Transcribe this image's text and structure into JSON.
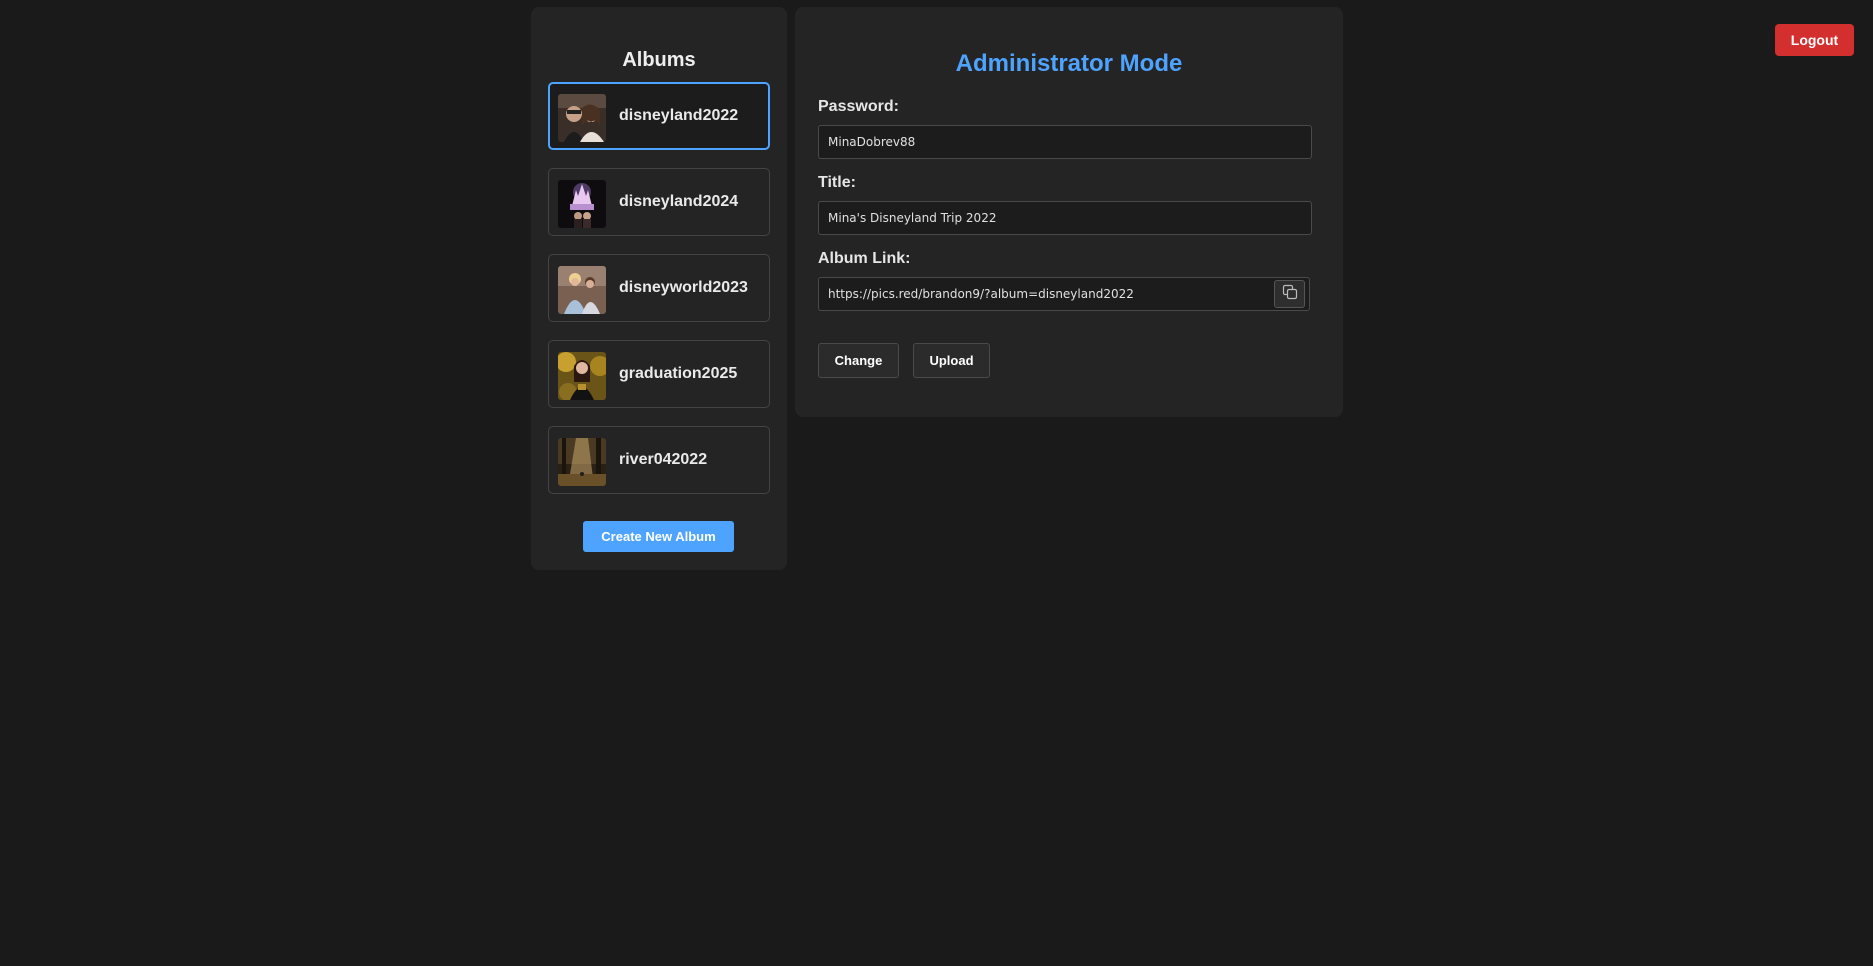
{
  "header": {
    "logout_label": "Logout",
    "logout_color": "#d32f2f"
  },
  "albums": {
    "title": "Albums",
    "items": [
      {
        "name": "disneyland2022",
        "selected": true
      },
      {
        "name": "disneyland2024",
        "selected": false
      },
      {
        "name": "disneyworld2023",
        "selected": false
      },
      {
        "name": "graduation2025",
        "selected": false
      },
      {
        "name": "river042022",
        "selected": false
      }
    ],
    "create_label": "Create New Album"
  },
  "admin": {
    "title": "Administrator Mode",
    "password_label": "Password:",
    "password_value": "MinaDobrev88",
    "title_label": "Title:",
    "title_value": "Mina's Disneyland Trip 2022",
    "link_label": "Album Link:",
    "link_value": "https://pics.red/brandon9/?album=disneyland2022",
    "change_label": "Change",
    "upload_label": "Upload"
  },
  "colors": {
    "accent": "#4ea3ff",
    "background": "#1a1a1a",
    "panel": "#242424",
    "danger": "#d32f2f"
  }
}
